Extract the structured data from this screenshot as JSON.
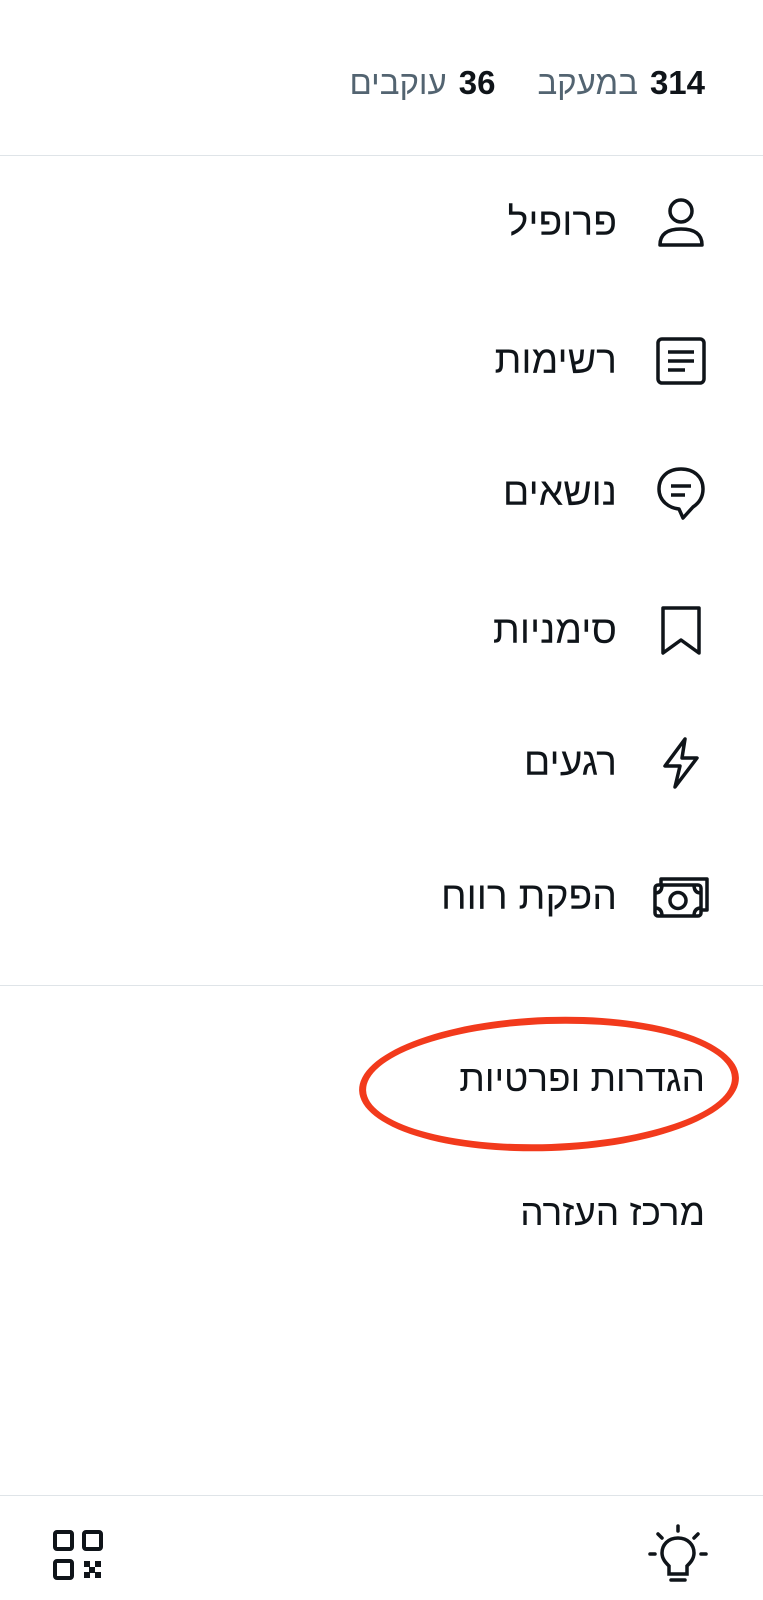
{
  "stats": {
    "following_count": "314",
    "following_label": "במעקב",
    "followers_count": "36",
    "followers_label": "עוקבים"
  },
  "menu": {
    "items": [
      {
        "label": "פרופיל",
        "icon": "profile-icon"
      },
      {
        "label": "רשימות",
        "icon": "lists-icon"
      },
      {
        "label": "נושאים",
        "icon": "topics-icon"
      },
      {
        "label": "סימניות",
        "icon": "bookmark-icon"
      },
      {
        "label": "רגעים",
        "icon": "moments-icon"
      },
      {
        "label": "הפקת רווח",
        "icon": "monetization-icon"
      }
    ]
  },
  "secondary": {
    "settings_label": "הגדרות ופרטיות",
    "help_label": "מרכז העזרה"
  },
  "bottom_bar": {
    "left_icon": "qr-code-icon",
    "right_icon": "lightbulb-icon"
  },
  "colors": {
    "text": "#0f1419",
    "secondary_text": "#536471",
    "divider": "#dfe4e8",
    "annotation": "#f23a1c"
  }
}
